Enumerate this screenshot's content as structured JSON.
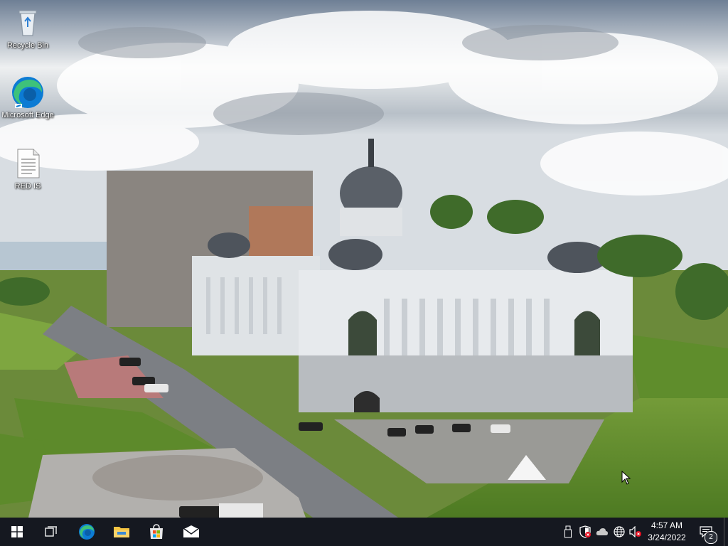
{
  "desktop": {
    "icons": [
      {
        "label": "Recycle Bin",
        "icon": "recycle-bin-icon"
      },
      {
        "label": "Microsoft Edge",
        "icon": "edge-icon"
      },
      {
        "label": "RED IS",
        "icon": "text-document-icon"
      }
    ],
    "wallpaper": "palace-of-farmers-kazan"
  },
  "taskbar": {
    "pinned": [
      {
        "name": "start",
        "icon": "windows-logo-icon"
      },
      {
        "name": "task-view",
        "icon": "task-view-icon"
      },
      {
        "name": "microsoft-edge",
        "icon": "edge-icon"
      },
      {
        "name": "file-explorer",
        "icon": "folder-icon"
      },
      {
        "name": "microsoft-store",
        "icon": "store-bag-icon"
      },
      {
        "name": "mail",
        "icon": "mail-icon"
      }
    ],
    "tray": [
      {
        "name": "usb",
        "icon": "usb-drive-icon"
      },
      {
        "name": "security",
        "icon": "shield-warning-icon"
      },
      {
        "name": "onedrive",
        "icon": "cloud-icon"
      },
      {
        "name": "network",
        "icon": "globe-icon"
      },
      {
        "name": "volume",
        "icon": "volume-muted-icon"
      }
    ],
    "clock": {
      "time": "4:57 AM",
      "date": "3/24/2022"
    },
    "notifications": {
      "count": "2"
    }
  },
  "colors": {
    "taskbar": "#151820",
    "edge_blue": "#0c7bd4",
    "edge_green": "#3ec27a",
    "folder_yellow": "#f6c543",
    "alert_red": "#e81123"
  }
}
